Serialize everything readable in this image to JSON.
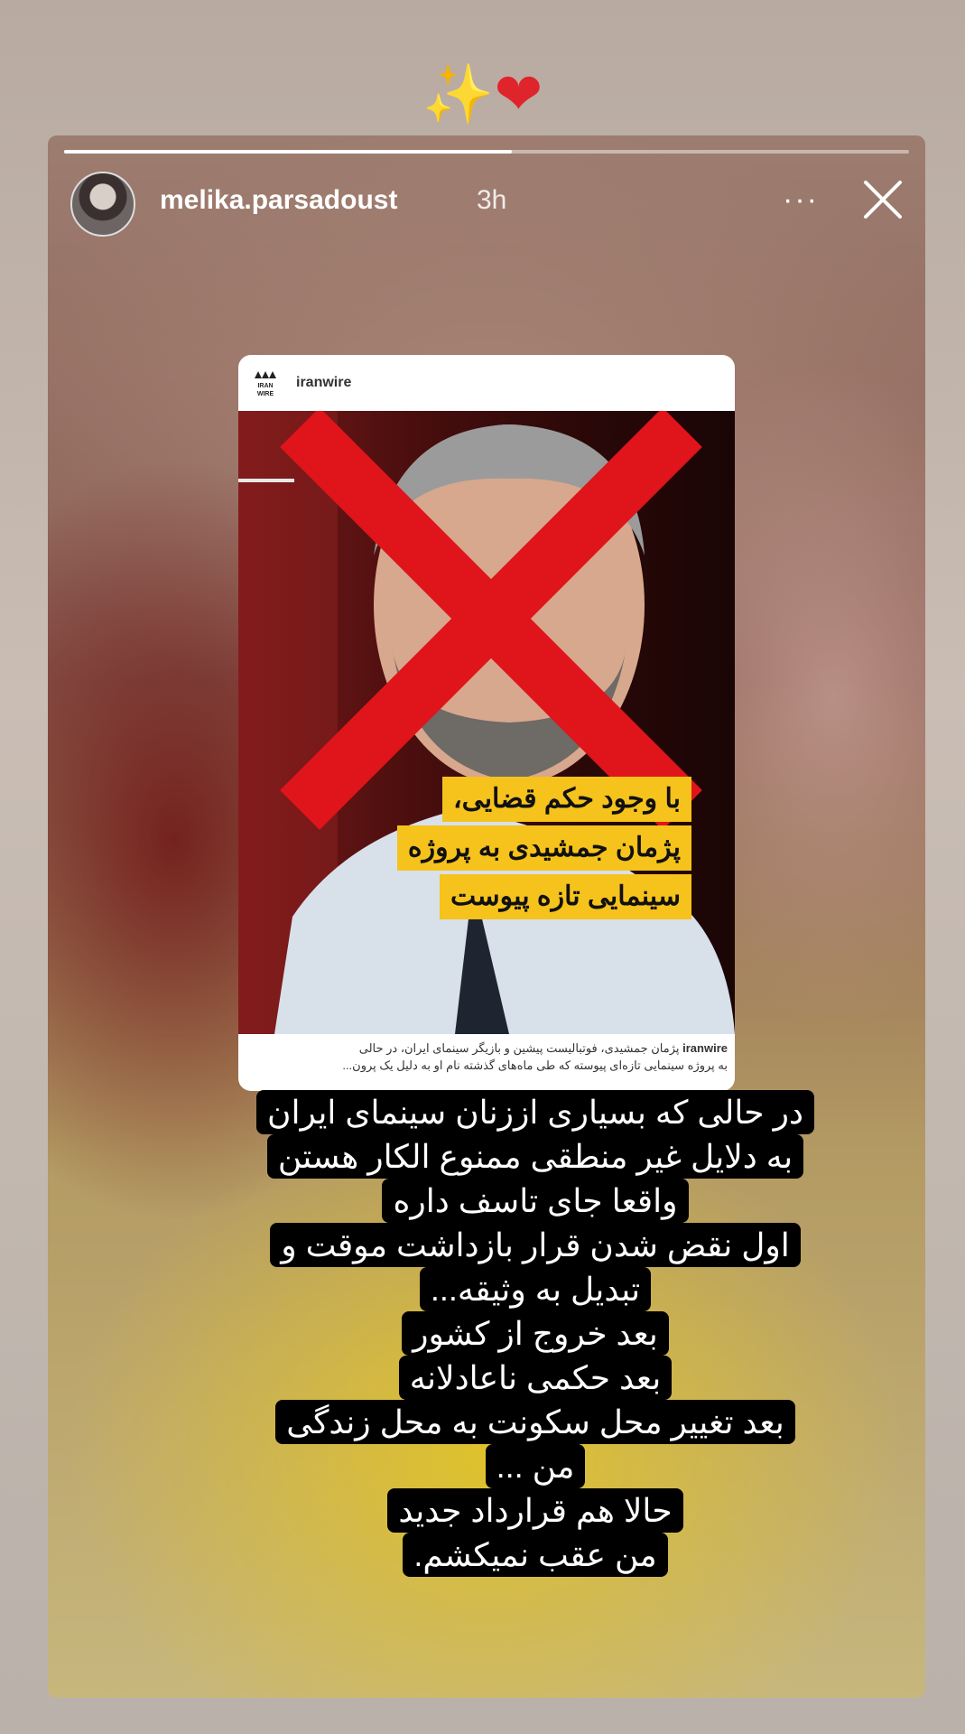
{
  "top_emojis": {
    "sparkle": "✨",
    "heart": "❤"
  },
  "story": {
    "progress": 0.53,
    "username": "melika.parsadoust",
    "time": "3h",
    "more_label": "···"
  },
  "post": {
    "account": "iranwire",
    "logo_text": [
      "IRAN",
      "WIRE"
    ],
    "headline_lines": [
      "با وجود حکم قضایی،",
      "پژمان جمشیدی به پروژه",
      "سینمایی تازه پیوست"
    ],
    "caption_account": "iranwire",
    "caption_line1": " پژمان جمشیدی، فوتبالیست پیشین و بازیگر سینمای ایران، در حالی",
    "caption_line2": "به پروژه سینمایی تازه‌ای پیوسته که طی ماه‌های گذشته نام او به دلیل یک پرون..."
  },
  "story_text": [
    "در حالی که بسیاری اززنان سینمای ایران",
    "به دلایل غیر منطقی ممنوع الکار هستن",
    "واقعا جای تاسف داره",
    "اول نقض شدن قرار بازداشت موقت و",
    "تبدیل به وثیقه...",
    "بعد خروج از کشور",
    "بعد حکمی ناعادلانه",
    "بعد تغییر محل سکونت به محل زندگی",
    "من ...",
    "حالا هم قرارداد جدید",
    "من عقب نمیکشم."
  ],
  "colors": {
    "headline_bg": "#f6c21c",
    "cross": "#e0141b",
    "text_bg": "#000000"
  }
}
